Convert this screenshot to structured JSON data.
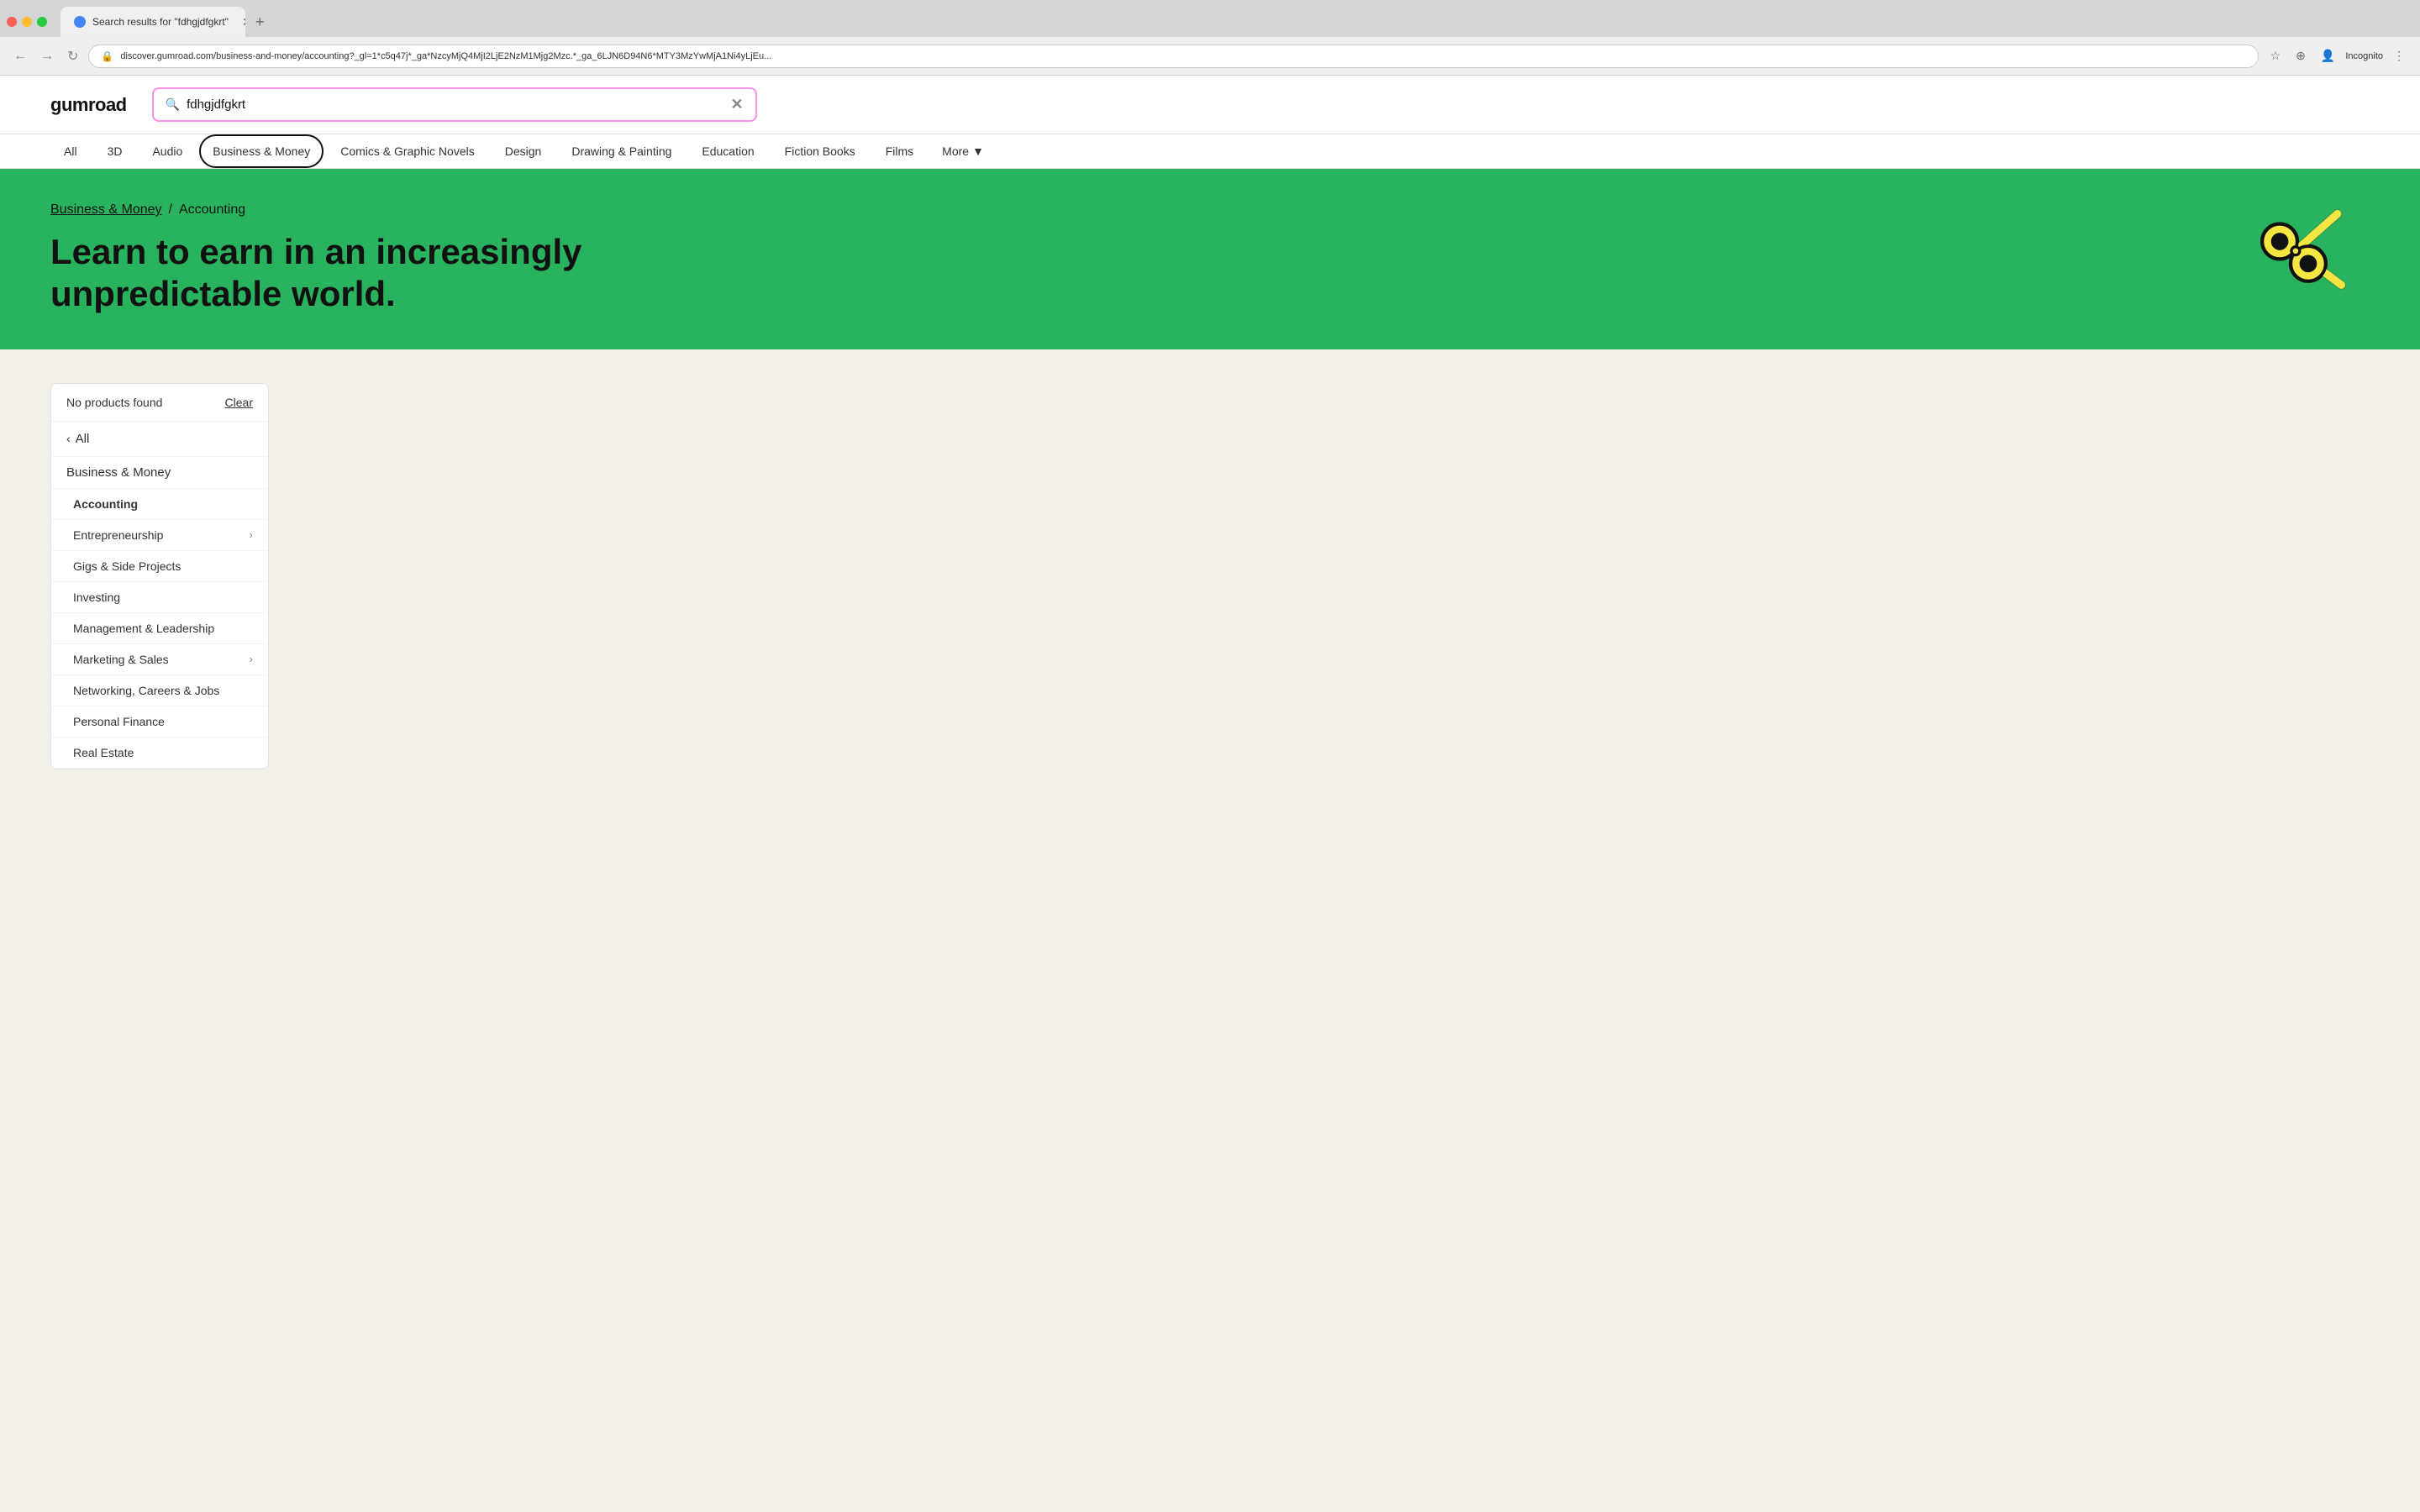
{
  "browser": {
    "tab_title": "Search results for \"fdhgjdfgkrt\"",
    "tab_favicon_color": "#4285f4",
    "address": "discover.gumroad.com/business-and-money/accounting?_gl=1*c5q47j*_ga*NzcyMjQ4MjI2LjE2NzM1Mjg2Mzc.*_ga_6LJN6D94N6*MTY3MzYwMjA1Ni4yLjEu...",
    "incognito_label": "Incognito"
  },
  "header": {
    "logo": "gumroad",
    "search_value": "fdhgjdfgkrt",
    "search_placeholder": "fdhgjdfgkrt"
  },
  "category_nav": {
    "items": [
      {
        "label": "All",
        "active": false
      },
      {
        "label": "3D",
        "active": false
      },
      {
        "label": "Audio",
        "active": false
      },
      {
        "label": "Business & Money",
        "active": true
      },
      {
        "label": "Comics & Graphic Novels",
        "active": false
      },
      {
        "label": "Design",
        "active": false
      },
      {
        "label": "Drawing & Painting",
        "active": false
      },
      {
        "label": "Education",
        "active": false
      },
      {
        "label": "Fiction Books",
        "active": false
      },
      {
        "label": "Films",
        "active": false
      }
    ],
    "more_label": "More"
  },
  "hero": {
    "breadcrumb_parent": "Business & Money",
    "breadcrumb_separator": "/",
    "breadcrumb_current": "Accounting",
    "title": "Learn to earn in an increasingly unpredictable world.",
    "bg_color": "#29b35e"
  },
  "sidebar": {
    "no_products_label": "No products found",
    "clear_label": "Clear",
    "back_label": "All",
    "category_title": "Business & Money",
    "items": [
      {
        "label": "Accounting",
        "active": true,
        "has_children": false
      },
      {
        "label": "Entrepreneurship",
        "active": false,
        "has_children": true
      },
      {
        "label": "Gigs & Side Projects",
        "active": false,
        "has_children": false
      },
      {
        "label": "Investing",
        "active": false,
        "has_children": false
      },
      {
        "label": "Management & Leadership",
        "active": false,
        "has_children": false
      },
      {
        "label": "Marketing & Sales",
        "active": false,
        "has_children": true
      },
      {
        "label": "Networking, Careers & Jobs",
        "active": false,
        "has_children": false
      },
      {
        "label": "Personal Finance",
        "active": false,
        "has_children": false
      },
      {
        "label": "Real Estate",
        "active": false,
        "has_children": false
      }
    ]
  }
}
